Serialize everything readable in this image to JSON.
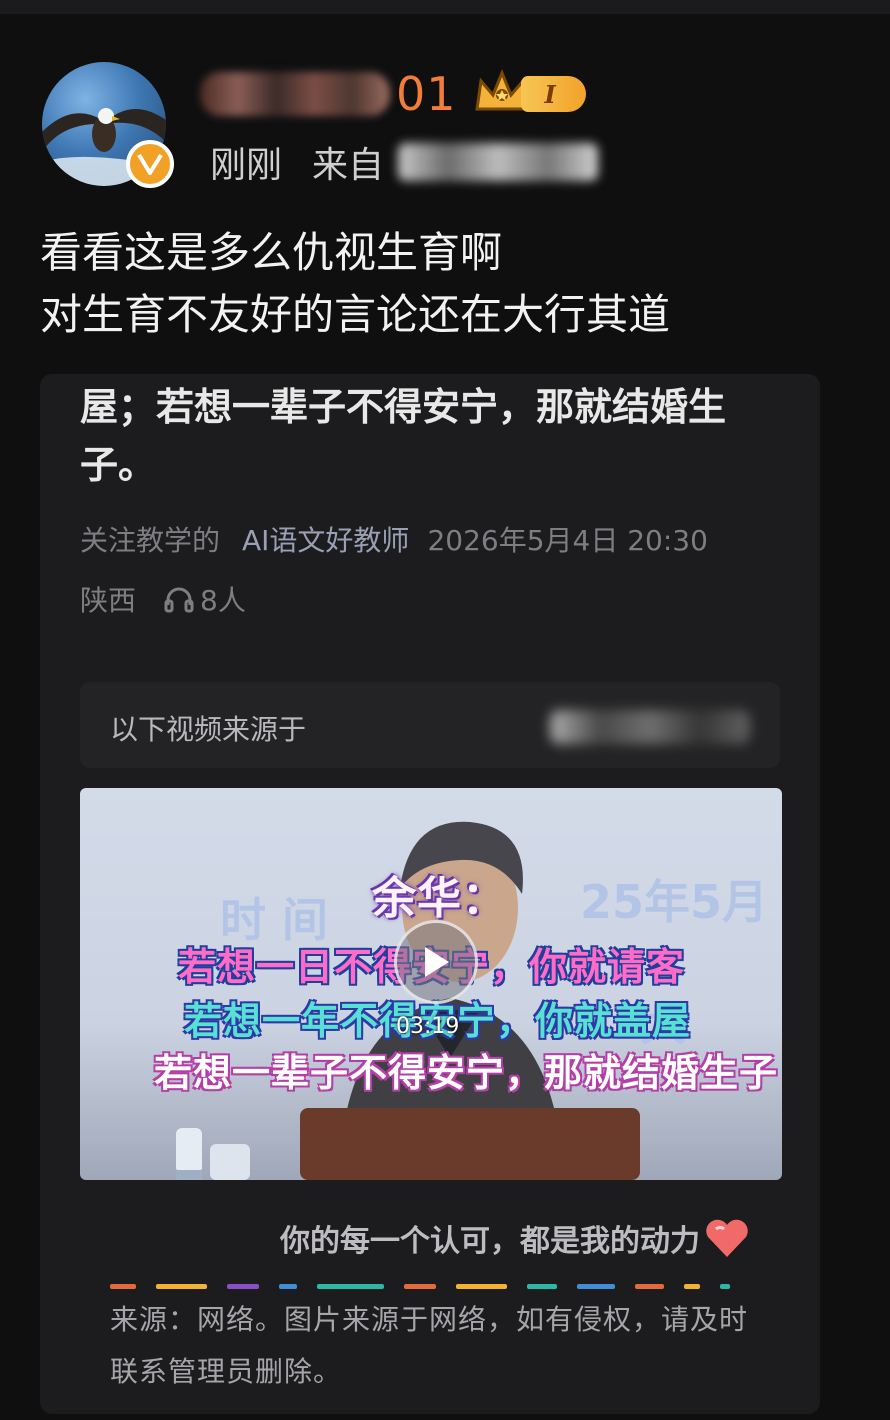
{
  "post": {
    "username_suffix": "01",
    "level": "I",
    "time": "刚刚",
    "from_label": "来自",
    "text_lines": [
      "看看这是多么仇视生育啊",
      "对生育不友好的言论还在大行其道"
    ]
  },
  "card": {
    "quote": "屋；若想一辈子不得安宁，那就结婚生子。",
    "author_prefix": "关注教学的",
    "author_name": "AI语文好教师",
    "datetime": "2026年5月4日 20:30",
    "location": "陕西",
    "listeners": "8人",
    "source_label": "以下视频来源于",
    "video": {
      "title": "余华：",
      "sub1": "若想一日不得安宁，你就请客",
      "sub2": "若想一年不得安宁，你就盖屋",
      "sub3": "若想一辈子不得安宁，那就结婚生子",
      "duration": "03:19"
    },
    "motto": "你的每一个认可，都是我的动力",
    "footnote": "来源：网络。图片来源于网络，如有侵权，请及时联系管理员删除。"
  },
  "colors": {
    "background": "#0f0f10",
    "card": "#1c1c1e",
    "username": "#f07d38",
    "badge": "#f2a127",
    "divider": [
      "#e36b3a",
      "#f2b233",
      "#8a4fc6",
      "#3f8fd8",
      "#2cb8a6",
      "#e36b3a",
      "#f2b233",
      "#2cb8a6",
      "#3f8fd8",
      "#e36b3a",
      "#f2b233",
      "#2cb8a6"
    ]
  },
  "icons": {
    "verify": "v-badge-icon",
    "crown": "crown-icon",
    "headphone": "headphone-icon",
    "play": "play-icon",
    "heart": "heart-icon"
  }
}
